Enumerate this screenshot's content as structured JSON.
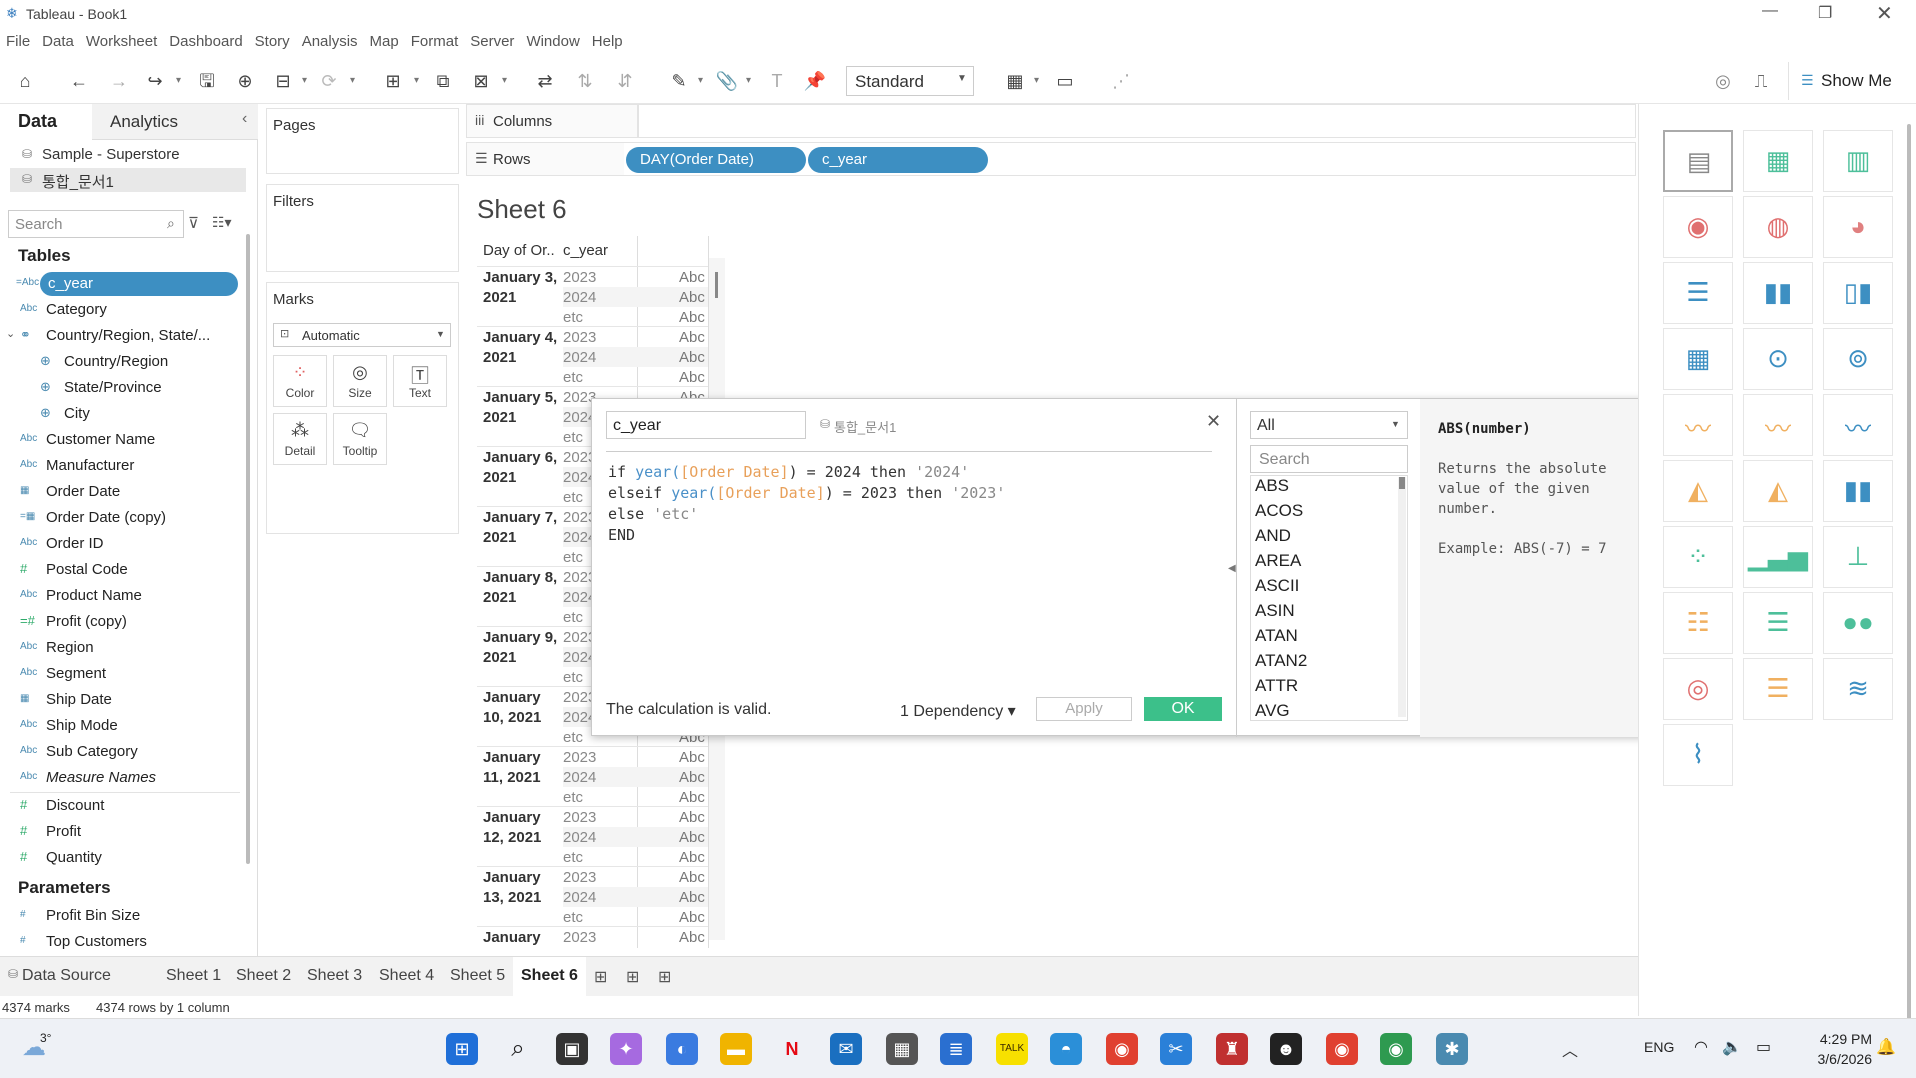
{
  "window": {
    "title": "Tableau - Book1"
  },
  "menu": [
    "File",
    "Data",
    "Worksheet",
    "Dashboard",
    "Story",
    "Analysis",
    "Map",
    "Format",
    "Server",
    "Window",
    "Help"
  ],
  "toolbar": {
    "view_mode": "Standard",
    "show_me": "Show Me"
  },
  "left_pane": {
    "tabs": {
      "data": "Data",
      "analytics": "Analytics"
    },
    "datasources": [
      "Sample - Superstore",
      "통합_문서1"
    ],
    "search_placeholder": "Search",
    "tables_header": "Tables",
    "fields": [
      {
        "type": "=Abc",
        "name": "c_year"
      },
      {
        "type": "Abc",
        "name": "Category"
      },
      {
        "type": "geo-hier",
        "name": "Country/Region, State/..."
      },
      {
        "type": "globe",
        "name": "Country/Region"
      },
      {
        "type": "globe",
        "name": "State/Province"
      },
      {
        "type": "globe",
        "name": "City"
      },
      {
        "type": "Abc",
        "name": "Customer Name"
      },
      {
        "type": "Abc",
        "name": "Manufacturer"
      },
      {
        "type": "date",
        "name": "Order Date"
      },
      {
        "type": "=date",
        "name": "Order Date (copy)"
      },
      {
        "type": "Abc",
        "name": "Order ID"
      },
      {
        "type": "#",
        "name": "Postal Code"
      },
      {
        "type": "Abc",
        "name": "Product Name"
      },
      {
        "type": "=#",
        "name": "Profit (copy)"
      },
      {
        "type": "Abc",
        "name": "Region"
      },
      {
        "type": "Abc",
        "name": "Segment"
      },
      {
        "type": "date",
        "name": "Ship Date"
      },
      {
        "type": "Abc",
        "name": "Ship Mode"
      },
      {
        "type": "Abc",
        "name": "Sub Category"
      },
      {
        "type": "Abc",
        "name": "Measure Names"
      },
      {
        "type": "#",
        "name": "Discount"
      },
      {
        "type": "#",
        "name": "Profit"
      },
      {
        "type": "#",
        "name": "Quantity"
      }
    ],
    "parameters_header": "Parameters",
    "parameters": [
      "Profit Bin Size",
      "Top Customers"
    ]
  },
  "cards": {
    "pages": "Pages",
    "filters": "Filters",
    "marks": "Marks",
    "mark_type": "Automatic",
    "mark_buttons": [
      "Color",
      "Size",
      "Text",
      "Detail",
      "Tooltip"
    ]
  },
  "shelves": {
    "columns_label": "Columns",
    "rows_label": "Rows",
    "rows_pills": [
      "DAY(Order Date)",
      "c_year"
    ]
  },
  "sheet": {
    "title": "Sheet 6",
    "header_col1": "Day of Or..",
    "header_col2": "c_year",
    "groups": [
      {
        "date": [
          "January 3,",
          "2021"
        ],
        "years": [
          "2023",
          "2024",
          "etc"
        ]
      },
      {
        "date": [
          "January 4,",
          "2021"
        ],
        "years": [
          "2023",
          "2024",
          "etc"
        ]
      },
      {
        "date": [
          "January 5,",
          "2021"
        ],
        "years": [
          "2023",
          "2024",
          "etc"
        ]
      },
      {
        "date": [
          "January 6,",
          "2021"
        ],
        "years": [
          "2023",
          "2024",
          "etc"
        ]
      },
      {
        "date": [
          "January 7,",
          "2021"
        ],
        "years": [
          "2023",
          "2024",
          "etc"
        ]
      },
      {
        "date": [
          "January 8,",
          "2021"
        ],
        "years": [
          "2023",
          "2024",
          "etc"
        ]
      },
      {
        "date": [
          "January 9,",
          "2021"
        ],
        "years": [
          "2023",
          "2024",
          "etc"
        ]
      },
      {
        "date": [
          "January",
          "10, 2021"
        ],
        "years": [
          "2023",
          "2024",
          "etc"
        ]
      },
      {
        "date": [
          "January",
          "11, 2021"
        ],
        "years": [
          "2023",
          "2024",
          "etc"
        ]
      },
      {
        "date": [
          "January",
          "12, 2021"
        ],
        "years": [
          "2023",
          "2024",
          "etc"
        ]
      },
      {
        "date": [
          "January",
          "13, 2021"
        ],
        "years": [
          "2023",
          "2024",
          "etc"
        ]
      },
      {
        "date": [
          "January",
          ""
        ],
        "years": [
          "2023"
        ]
      }
    ],
    "cell_value": "Abc"
  },
  "calc_dialog": {
    "name": "c_year",
    "datasource": "통합_문서1",
    "code_lines": [
      [
        [
          "kw",
          "if "
        ],
        [
          "fn",
          "year("
        ],
        [
          "fld",
          "[Order Date]"
        ],
        [
          "kw",
          ") = 2024 then "
        ],
        [
          "str",
          "'2024'"
        ]
      ],
      [
        [
          "kw",
          "elseif "
        ],
        [
          "fn",
          "year("
        ],
        [
          "fld",
          "[Order Date]"
        ],
        [
          "kw",
          ") = 2023 then "
        ],
        [
          "str",
          "'2023'"
        ]
      ],
      [
        [
          "kw",
          "else "
        ],
        [
          "str",
          "'etc'"
        ]
      ],
      [
        [
          "kw",
          "END"
        ]
      ]
    ],
    "status": "The calculation is valid.",
    "dependency": "1 Dependency",
    "apply": "Apply",
    "ok": "OK",
    "category": "All",
    "search_placeholder": "Search",
    "functions": [
      "ABS",
      "ACOS",
      "AND",
      "AREA",
      "ASCII",
      "ASIN",
      "ATAN",
      "ATAN2",
      "ATTR",
      "AVG"
    ],
    "help_title": "ABS(number)",
    "help_body": [
      "Returns the absolute",
      "value of the given",
      "number.",
      "",
      "Example: ABS(-7) = 7"
    ]
  },
  "sheet_tabs": {
    "datasource": "Data Source",
    "sheets": [
      "Sheet 1",
      "Sheet 2",
      "Sheet 3",
      "Sheet 4",
      "Sheet 5",
      "Sheet 6"
    ],
    "active": "Sheet 6"
  },
  "status_bar": {
    "marks": "4374 marks",
    "rows": "4374 rows by 1 column"
  },
  "taskbar": {
    "weather": "3°",
    "lang": "ENG",
    "time": "4:29 PM",
    "date": "3/6/2026"
  }
}
